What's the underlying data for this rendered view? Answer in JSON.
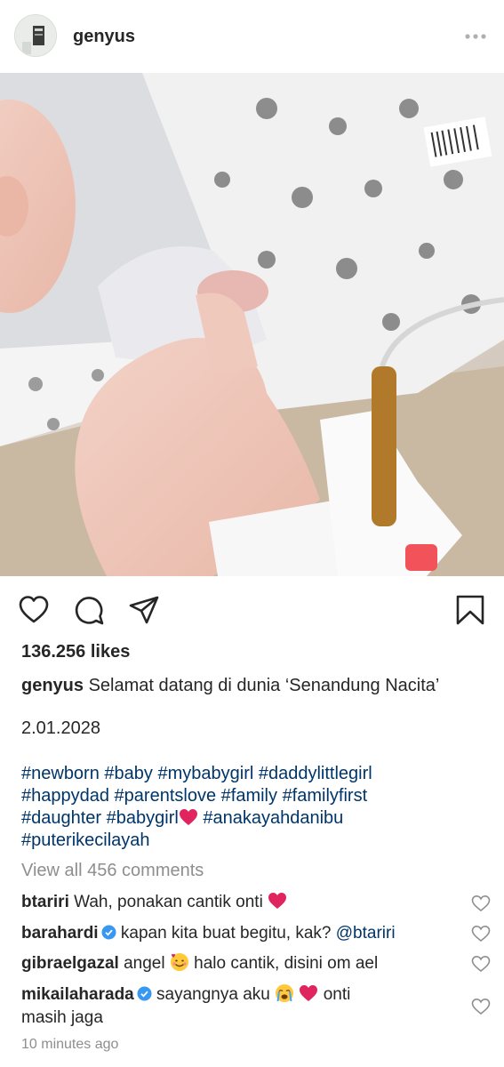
{
  "post": {
    "username": "genyus",
    "likes": "136.256 likes",
    "caption_user": "genyus",
    "caption_text": "Selamat datang di dunia ‘Senandung Nacita’",
    "date_text": "2.01.2028",
    "hashtags": {
      "h1": "#newborn",
      "h2": "#baby",
      "h3": "#mybabygirl",
      "h4": "#daddylittlegirl",
      "h5": "#happydad",
      "h6": "#parentslove",
      "h7": "#family",
      "h8": "#familyfirst",
      "h9": "#daughter",
      "h10": "#babygirl",
      "h11": "#anakayahdanibu",
      "h12": "#puterikecilayah"
    },
    "view_all": "View all 456 comments",
    "timestamp": "10 minutes ago"
  },
  "comments": [
    {
      "user": "btariri",
      "text": "Wah, ponakan cantik onti",
      "verified": false
    },
    {
      "user": "barahardi",
      "text": "kapan kita buat begitu, kak?",
      "mention": "@btariri",
      "verified": true
    },
    {
      "user": "gibraelgazal",
      "text_before": "angel",
      "text_after": "halo cantik, disini om ael",
      "verified": false
    },
    {
      "user": "mikailaharada",
      "text_before": "sayangnya aku",
      "text_after": "onti",
      "text_line2": "masih jaga",
      "verified": true
    }
  ],
  "icons": {
    "more": "more-dots-icon",
    "like": "heart-icon",
    "comment": "comment-bubble-icon",
    "share": "paper-plane-icon",
    "save": "bookmark-icon",
    "verified": "verified-badge-icon"
  },
  "colors": {
    "text": "#262626",
    "hashtag": "#003569",
    "muted": "#8e8e8e",
    "verified": "#3897f0",
    "heart_emoji": "#e0245e"
  }
}
